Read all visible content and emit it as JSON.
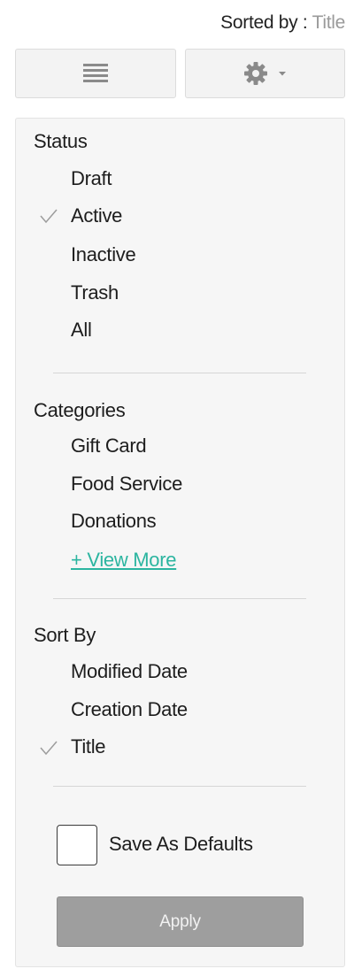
{
  "header": {
    "sorted_by_label": "Sorted by : ",
    "sorted_by_value": "Title"
  },
  "toolbar": {
    "list_icon": "list-icon",
    "settings_icon": "gear-icon",
    "dropdown_icon": "caret-down-icon"
  },
  "filters": {
    "status": {
      "title": "Status",
      "options": [
        {
          "label": "Draft",
          "checked": false
        },
        {
          "label": "Active",
          "checked": true
        },
        {
          "label": "Inactive",
          "checked": false
        },
        {
          "label": "Trash",
          "checked": false
        },
        {
          "label": "All",
          "checked": false
        }
      ]
    },
    "categories": {
      "title": "Categories",
      "options": [
        {
          "label": "Gift Card"
        },
        {
          "label": "Food Service"
        },
        {
          "label": "Donations"
        }
      ],
      "view_more": "+ View More"
    },
    "sort_by": {
      "title": "Sort By",
      "options": [
        {
          "label": "Modified Date",
          "checked": false
        },
        {
          "label": "Creation Date",
          "checked": false
        },
        {
          "label": "Title",
          "checked": true
        }
      ]
    }
  },
  "footer": {
    "save_defaults_label": "Save As Defaults",
    "save_defaults_checked": false,
    "apply_label": "Apply"
  },
  "colors": {
    "link": "#2cb5a0",
    "apply_button": "#9e9e9e",
    "muted_text": "#9a9a9a"
  }
}
